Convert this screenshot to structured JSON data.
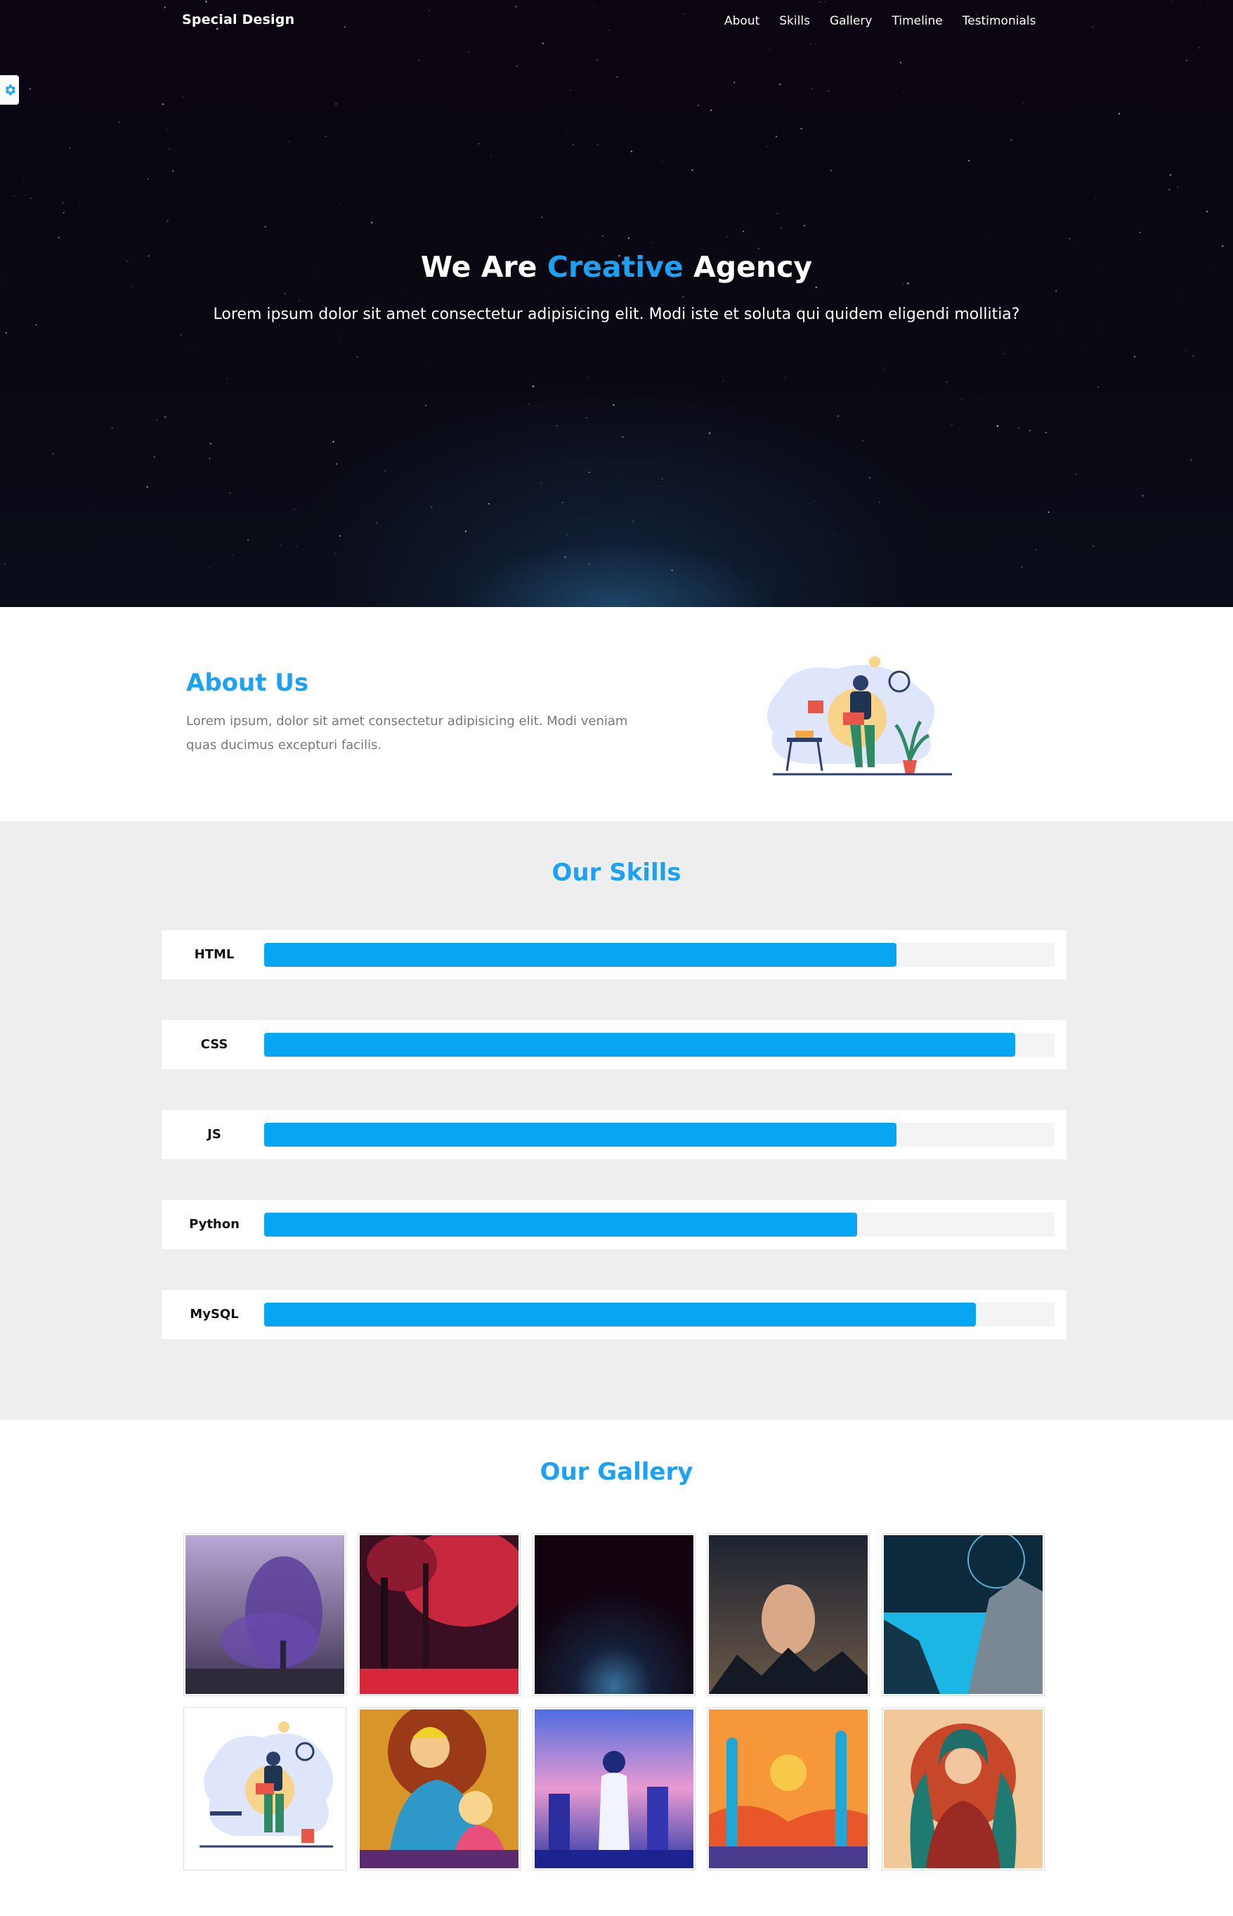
{
  "header": {
    "logo": "Special Design",
    "nav": [
      "About",
      "Skills",
      "Gallery",
      "Timeline",
      "Testimonials"
    ]
  },
  "settings": {
    "icon": "gear-icon",
    "color": "#1da1f2"
  },
  "hero": {
    "title_before": "We Are ",
    "title_accent": "Creative",
    "title_after": " Agency",
    "subtitle": "Lorem ipsum dolor sit amet consectetur adipisicing elit. Modi iste et soluta qui quidem eligendi mollitia?"
  },
  "about": {
    "title": "About Us",
    "text": "Lorem ipsum, dolor sit amet consectetur adipisicing elit. Modi veniam quas ducimus excepturi facilis."
  },
  "skills": {
    "title": "Our Skills",
    "items": [
      {
        "name": "HTML",
        "percent": 80
      },
      {
        "name": "CSS",
        "percent": 95
      },
      {
        "name": "JS",
        "percent": 80
      },
      {
        "name": "Python",
        "percent": 75
      },
      {
        "name": "MySQL",
        "percent": 90
      }
    ]
  },
  "gallery": {
    "title": "Our Gallery",
    "images": [
      "purple-tree-image",
      "red-forest-image",
      "dark-space-image",
      "egg-planet-image",
      "blue-canyon-image",
      "person-laptop-illustration",
      "father-daughter-illustration",
      "woman-city-illustration",
      "desert-cactus-illustration",
      "woman-portrait-illustration"
    ]
  },
  "colors": {
    "accent": "#1da1f2",
    "bar": "#08a6f2",
    "skills_bg": "#eeeeee",
    "hero_bg": "#0b0612"
  }
}
